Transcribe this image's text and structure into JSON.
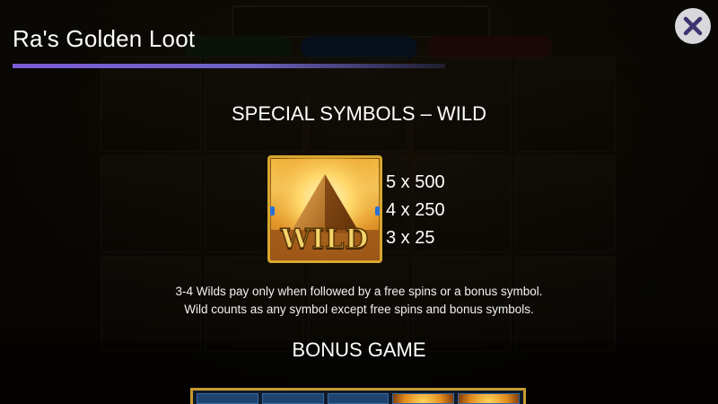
{
  "header": {
    "title": "Ra's Golden Loot"
  },
  "close_button": {
    "icon": "close-icon"
  },
  "wild_section": {
    "title": "SPECIAL SYMBOLS – WILD",
    "symbol_label": "WILD",
    "payouts": [
      "5 x 500",
      "4 x 250",
      "3 x 25"
    ],
    "description_lines": [
      "3-4 Wilds pay only when followed by a free spins or a bonus symbol.",
      "Wild counts as any symbol except free spins and bonus symbols."
    ]
  },
  "bonus_section": {
    "title": "BONUS GAME"
  },
  "colors": {
    "accent_line": "#7c5cd6",
    "close_bg": "#d8d8dc",
    "gold_border": "#d9a72e"
  }
}
